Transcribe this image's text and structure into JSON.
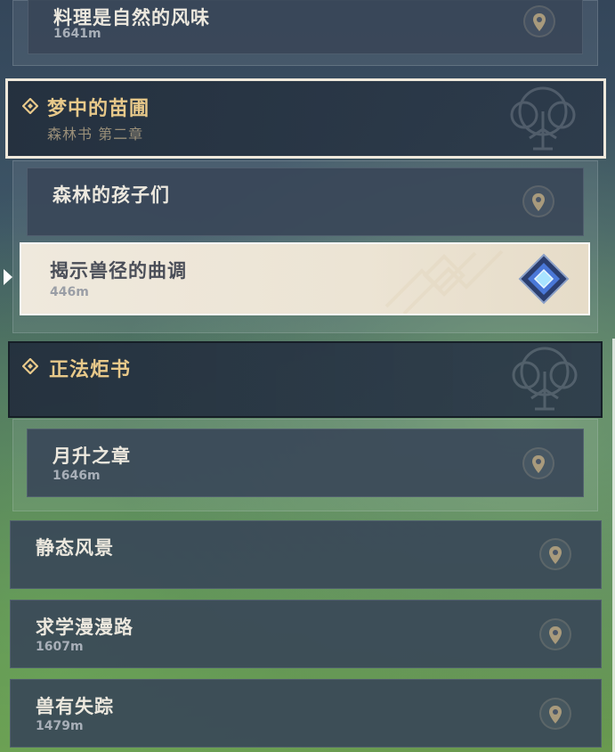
{
  "quests": {
    "top_item": {
      "title": "料理是自然的风味",
      "distance": "1641m"
    },
    "chapter1": {
      "title": "梦中的苗圃",
      "subtitle": "森林书 第二章"
    },
    "item_forest_children": {
      "title": "森林的孩子们"
    },
    "item_selected": {
      "title": "揭示兽径的曲调",
      "distance": "446m"
    },
    "chapter2": {
      "title": "正法炬书"
    },
    "item_moonrise": {
      "title": "月升之章",
      "distance": "1646m"
    },
    "item_static": {
      "title": "静态风景"
    },
    "item_study": {
      "title": "求学漫漫路",
      "distance": "1607m"
    },
    "item_lost": {
      "title": "兽有失踪",
      "distance": "1479m"
    }
  },
  "colors": {
    "gold": "#e8c98a",
    "selected_bg": "#efe9dd",
    "marker_blue": "#5a8fe0"
  },
  "icons": [
    "location-pin-icon",
    "chapter-diamond-icon",
    "tree-emblem-icon",
    "quest-marker-icon"
  ]
}
